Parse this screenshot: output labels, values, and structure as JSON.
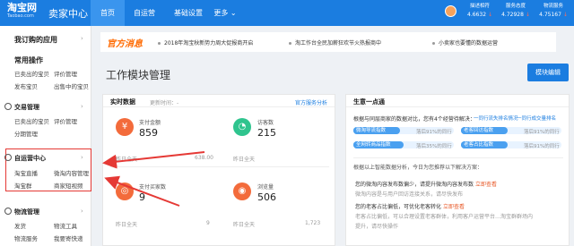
{
  "topbar": {
    "logo_main": "淘宝网",
    "logo_domain": "Taobao.com",
    "logo_sub": "卖家中心",
    "nav": [
      "首页",
      "自运营",
      "基础设置",
      "更多 ⌄"
    ],
    "stats": [
      {
        "label": "描述相符",
        "value": "4.6632",
        "dir": "↓"
      },
      {
        "label": "服务态度",
        "value": "4.72928",
        "dir": "↓"
      },
      {
        "label": "物流服务",
        "value": "4.75167",
        "dir": "↓"
      }
    ]
  },
  "sidebar": {
    "my_apps": "我订购的应用",
    "common_ops": "常用操作",
    "common_links": [
      "已卖出的宝贝",
      "评价管理",
      "发布宝贝",
      "出售中的宝贝"
    ],
    "trade": {
      "title": "交易管理",
      "links": [
        "已卖出的宝贝",
        "评价管理",
        "分期管理"
      ]
    },
    "self_ops": {
      "title": "自运营中心",
      "links": [
        "淘宝直播",
        "微淘内容管理",
        "淘宝群",
        "商家短视频"
      ]
    },
    "logistics": {
      "title": "物流管理",
      "links": [
        "发货",
        "物流工具",
        "物流服务",
        "我要寄快递"
      ]
    }
  },
  "notice": {
    "label": "官方消息",
    "items": [
      "2018年淘宝秋新势力周大促报商开启",
      "淘工作台全民加薪狂欢节火热报商中",
      "小卖家也要懂的数据运营"
    ]
  },
  "page": {
    "title": "工作模块管理",
    "edit_button": "模块编辑"
  },
  "realtime": {
    "title": "实时数据",
    "updated": "更新时间：-",
    "link": "官方服务分析",
    "metrics": [
      {
        "label": "支付金额",
        "value": "859",
        "foot_label": "昨日全天",
        "foot_value": "638.00",
        "icon": "¥",
        "color": "#f36b3b"
      },
      {
        "label": "访客数",
        "value": "215",
        "foot_label": "昨日全天",
        "foot_value": "",
        "icon": "◔",
        "color": "#2fc48e"
      },
      {
        "label": "支付买家数",
        "value": "9",
        "foot_label": "昨日全天",
        "foot_value": "9",
        "icon": "◎",
        "color": "#f36b3b"
      },
      {
        "label": "浏览量",
        "value": "506",
        "foot_label": "昨日全天",
        "foot_value": "1,723",
        "icon": "◉",
        "color": "#f36b3b"
      }
    ]
  },
  "shengyi": {
    "title": "生意一点通",
    "desc": "根据与同层商家的数据对比，您有4个经营待解决：",
    "links": [
      "一同行流失排名情况",
      "一同行成交量排名"
    ],
    "pills": [
      {
        "label": "微淘导流指数",
        "note": "落后91%的同行",
        "fill": 0.2
      },
      {
        "label": "老客回访指数",
        "note": "落后91%的同行",
        "fill": 0.2
      },
      {
        "label": "全网转商品指数",
        "note": "落后35%的同行",
        "fill": 0.5
      },
      {
        "label": "老客占比指数",
        "note": "落后91%的同行",
        "fill": 0.2
      }
    ],
    "smart": "根据以上智能数据分析，今日为您推荐以下解决方案：",
    "advice": [
      {
        "text": "您的微淘内容发布数偏少，请提升微淘内容发布数",
        "link": "立即查看",
        "detail": "微淘内容是与用户回访连接关系，请尽快发布"
      },
      {
        "text": "您的老客占比偏低，可优化老客转化",
        "link": "立即查看",
        "detail": "老客占比偏低，可以合理设置老客群体，利用客户运营平台…淘宝群群场内"
      },
      {
        "text": "",
        "link": "",
        "detail": "提升，请尽快操作"
      }
    ]
  }
}
